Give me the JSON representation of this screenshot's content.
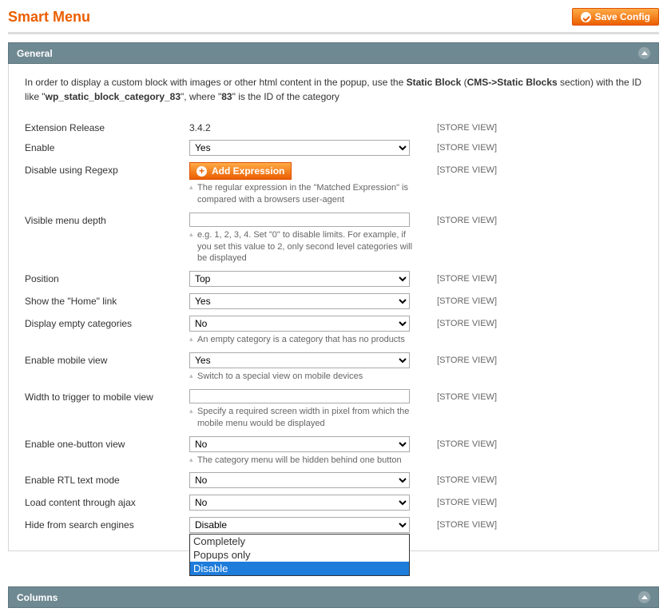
{
  "page_title": "Smart Menu",
  "save_button": "Save Config",
  "section_general": {
    "title": "General"
  },
  "info": {
    "prefix": "In order to display a custom block with images or other html content in the popup, use the ",
    "bold1": "Static Block",
    "mid1": " (",
    "bold2": "CMS->Static Blocks",
    "mid2": " section) with the ID like \"",
    "bold3": "wp_static_block_category_83",
    "mid3": "\", where \"",
    "bold4": "83",
    "suffix": "\" is the ID of the category"
  },
  "scope": "STORE VIEW",
  "fields": {
    "release": {
      "label": "Extension Release",
      "value": "3.4.2"
    },
    "enable": {
      "label": "Enable",
      "value": "Yes"
    },
    "regexp": {
      "label": "Disable using Regexp",
      "button": "Add Expression",
      "note": "The regular expression in the \"Matched Expression\" is compared with a browsers user-agent"
    },
    "depth": {
      "label": "Visible menu depth",
      "value": "",
      "note": "e.g. 1, 2, 3, 4. Set \"0\" to disable limits. For example, if you set this value to 2, only second level categories will be displayed"
    },
    "position": {
      "label": "Position",
      "value": "Top"
    },
    "home": {
      "label": "Show the \"Home\" link",
      "value": "Yes"
    },
    "empty": {
      "label": "Display empty categories",
      "value": "No",
      "note": "An empty category is a category that has no products"
    },
    "mobile": {
      "label": "Enable mobile view",
      "value": "Yes",
      "note": "Switch to a special view on mobile devices"
    },
    "mwidth": {
      "label": "Width to trigger to mobile view",
      "value": "",
      "note": "Specify a required screen width in pixel from which the mobile menu would be displayed"
    },
    "onebtn": {
      "label": "Enable one-button view",
      "value": "No",
      "note": "The category menu will be hidden behind one button"
    },
    "rtl": {
      "label": "Enable RTL text mode",
      "value": "No"
    },
    "ajax": {
      "label": "Load content through ajax",
      "value": "No"
    },
    "hide": {
      "label": "Hide from search engines",
      "value": "Disable",
      "options": [
        "Completely",
        "Popups only",
        "Disable"
      ]
    }
  },
  "section_columns": {
    "title": "Columns"
  }
}
